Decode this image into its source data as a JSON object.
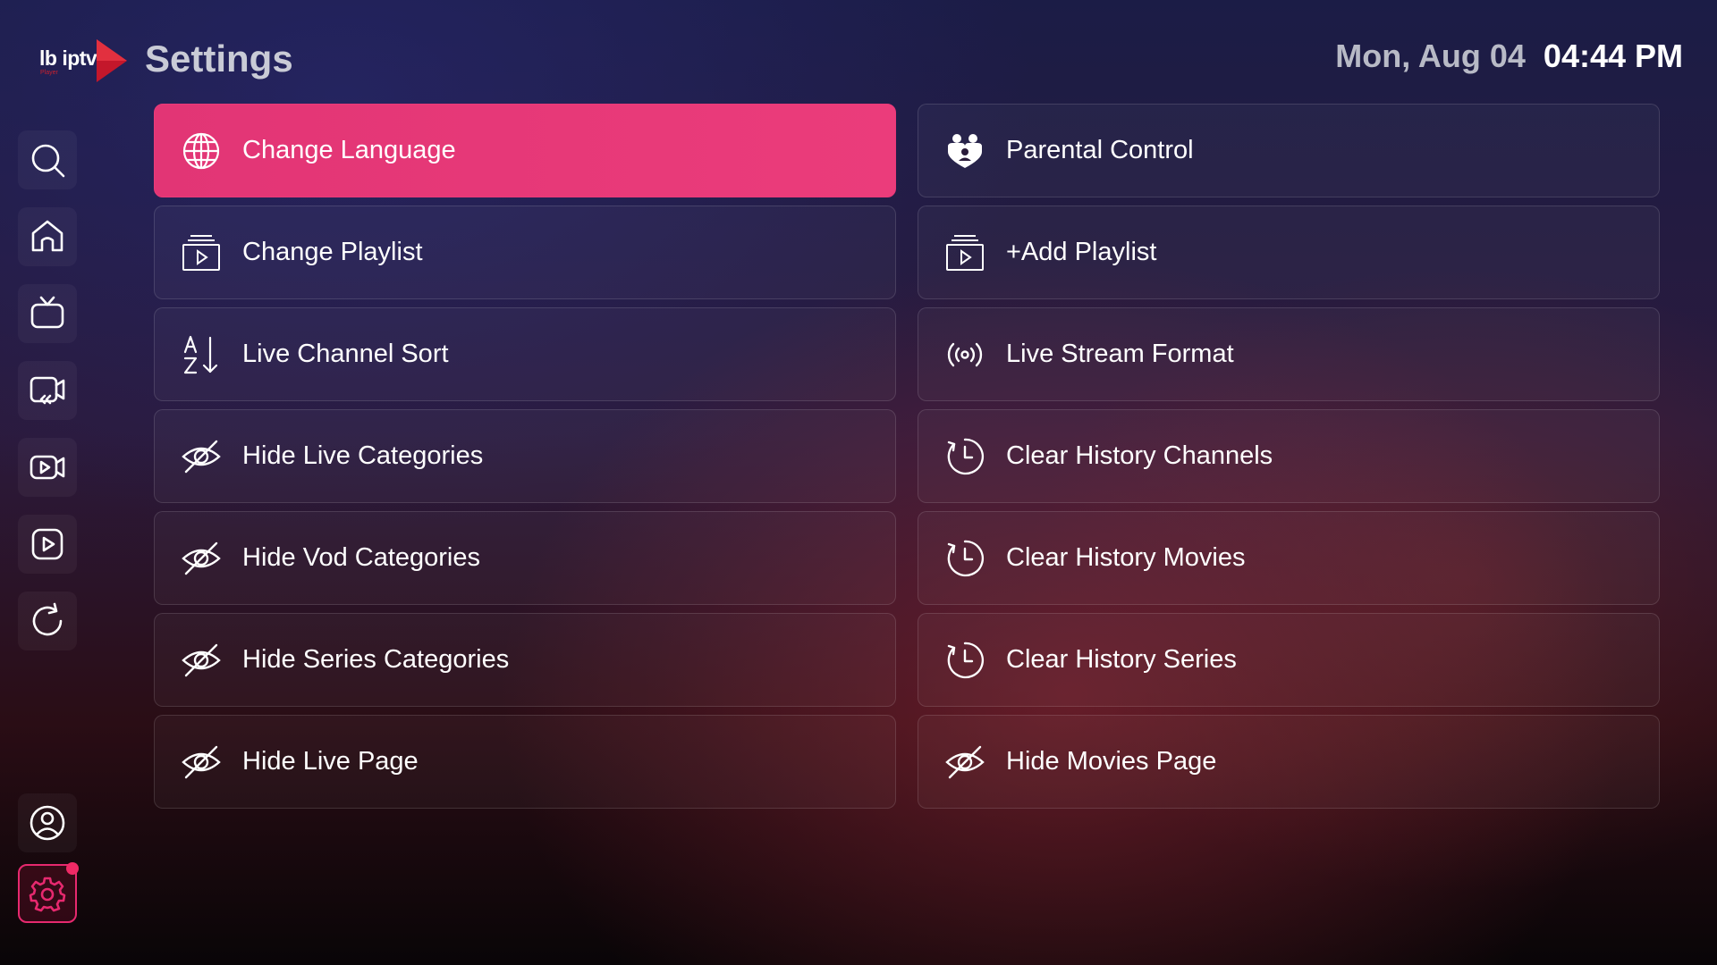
{
  "header": {
    "logo_text": "lb iptv",
    "logo_subtext": "Player",
    "title": "Settings",
    "date": "Mon, Aug 04",
    "time": "04:44 PM"
  },
  "sidebar": {
    "items": [
      {
        "icon": "search-icon"
      },
      {
        "icon": "home-icon"
      },
      {
        "icon": "tv-icon"
      },
      {
        "icon": "catchup-icon"
      },
      {
        "icon": "movies-icon"
      },
      {
        "icon": "series-icon"
      },
      {
        "icon": "refresh-icon"
      },
      {
        "icon": "profile-icon"
      },
      {
        "icon": "settings-icon",
        "active": true
      }
    ]
  },
  "settings": {
    "items": [
      {
        "label": "Change Language",
        "icon": "globe-icon",
        "selected": true
      },
      {
        "label": "Parental Control",
        "icon": "family-icon"
      },
      {
        "label": "Change Playlist",
        "icon": "playlist-icon"
      },
      {
        "label": "+Add Playlist",
        "icon": "playlist-icon"
      },
      {
        "label": "Live Channel Sort",
        "icon": "sort-az-icon"
      },
      {
        "label": "Live Stream Format",
        "icon": "broadcast-icon"
      },
      {
        "label": "Hide Live Categories",
        "icon": "eye-off-icon"
      },
      {
        "label": "Clear History Channels",
        "icon": "history-icon"
      },
      {
        "label": "Hide Vod Categories",
        "icon": "eye-off-icon"
      },
      {
        "label": "Clear History Movies",
        "icon": "history-icon"
      },
      {
        "label": "Hide Series Categories",
        "icon": "eye-off-icon"
      },
      {
        "label": "Clear History Series",
        "icon": "history-icon"
      },
      {
        "label": "Hide Live Page",
        "icon": "eye-off-icon"
      },
      {
        "label": "Hide Movies Page",
        "icon": "eye-off-icon"
      }
    ]
  },
  "colors": {
    "accent": "#e8387a",
    "notification": "#ef2a66"
  }
}
